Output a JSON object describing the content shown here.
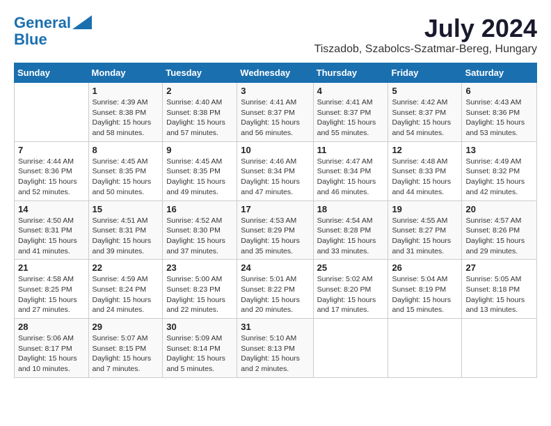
{
  "logo": {
    "text1": "General",
    "text2": "Blue"
  },
  "title": "July 2024",
  "location": "Tiszadob, Szabolcs-Szatmar-Bereg, Hungary",
  "headers": [
    "Sunday",
    "Monday",
    "Tuesday",
    "Wednesday",
    "Thursday",
    "Friday",
    "Saturday"
  ],
  "weeks": [
    [
      {
        "day": "",
        "info": ""
      },
      {
        "day": "1",
        "info": "Sunrise: 4:39 AM\nSunset: 8:38 PM\nDaylight: 15 hours\nand 58 minutes."
      },
      {
        "day": "2",
        "info": "Sunrise: 4:40 AM\nSunset: 8:38 PM\nDaylight: 15 hours\nand 57 minutes."
      },
      {
        "day": "3",
        "info": "Sunrise: 4:41 AM\nSunset: 8:37 PM\nDaylight: 15 hours\nand 56 minutes."
      },
      {
        "day": "4",
        "info": "Sunrise: 4:41 AM\nSunset: 8:37 PM\nDaylight: 15 hours\nand 55 minutes."
      },
      {
        "day": "5",
        "info": "Sunrise: 4:42 AM\nSunset: 8:37 PM\nDaylight: 15 hours\nand 54 minutes."
      },
      {
        "day": "6",
        "info": "Sunrise: 4:43 AM\nSunset: 8:36 PM\nDaylight: 15 hours\nand 53 minutes."
      }
    ],
    [
      {
        "day": "7",
        "info": "Sunrise: 4:44 AM\nSunset: 8:36 PM\nDaylight: 15 hours\nand 52 minutes."
      },
      {
        "day": "8",
        "info": "Sunrise: 4:45 AM\nSunset: 8:35 PM\nDaylight: 15 hours\nand 50 minutes."
      },
      {
        "day": "9",
        "info": "Sunrise: 4:45 AM\nSunset: 8:35 PM\nDaylight: 15 hours\nand 49 minutes."
      },
      {
        "day": "10",
        "info": "Sunrise: 4:46 AM\nSunset: 8:34 PM\nDaylight: 15 hours\nand 47 minutes."
      },
      {
        "day": "11",
        "info": "Sunrise: 4:47 AM\nSunset: 8:34 PM\nDaylight: 15 hours\nand 46 minutes."
      },
      {
        "day": "12",
        "info": "Sunrise: 4:48 AM\nSunset: 8:33 PM\nDaylight: 15 hours\nand 44 minutes."
      },
      {
        "day": "13",
        "info": "Sunrise: 4:49 AM\nSunset: 8:32 PM\nDaylight: 15 hours\nand 42 minutes."
      }
    ],
    [
      {
        "day": "14",
        "info": "Sunrise: 4:50 AM\nSunset: 8:31 PM\nDaylight: 15 hours\nand 41 minutes."
      },
      {
        "day": "15",
        "info": "Sunrise: 4:51 AM\nSunset: 8:31 PM\nDaylight: 15 hours\nand 39 minutes."
      },
      {
        "day": "16",
        "info": "Sunrise: 4:52 AM\nSunset: 8:30 PM\nDaylight: 15 hours\nand 37 minutes."
      },
      {
        "day": "17",
        "info": "Sunrise: 4:53 AM\nSunset: 8:29 PM\nDaylight: 15 hours\nand 35 minutes."
      },
      {
        "day": "18",
        "info": "Sunrise: 4:54 AM\nSunset: 8:28 PM\nDaylight: 15 hours\nand 33 minutes."
      },
      {
        "day": "19",
        "info": "Sunrise: 4:55 AM\nSunset: 8:27 PM\nDaylight: 15 hours\nand 31 minutes."
      },
      {
        "day": "20",
        "info": "Sunrise: 4:57 AM\nSunset: 8:26 PM\nDaylight: 15 hours\nand 29 minutes."
      }
    ],
    [
      {
        "day": "21",
        "info": "Sunrise: 4:58 AM\nSunset: 8:25 PM\nDaylight: 15 hours\nand 27 minutes."
      },
      {
        "day": "22",
        "info": "Sunrise: 4:59 AM\nSunset: 8:24 PM\nDaylight: 15 hours\nand 24 minutes."
      },
      {
        "day": "23",
        "info": "Sunrise: 5:00 AM\nSunset: 8:23 PM\nDaylight: 15 hours\nand 22 minutes."
      },
      {
        "day": "24",
        "info": "Sunrise: 5:01 AM\nSunset: 8:22 PM\nDaylight: 15 hours\nand 20 minutes."
      },
      {
        "day": "25",
        "info": "Sunrise: 5:02 AM\nSunset: 8:20 PM\nDaylight: 15 hours\nand 17 minutes."
      },
      {
        "day": "26",
        "info": "Sunrise: 5:04 AM\nSunset: 8:19 PM\nDaylight: 15 hours\nand 15 minutes."
      },
      {
        "day": "27",
        "info": "Sunrise: 5:05 AM\nSunset: 8:18 PM\nDaylight: 15 hours\nand 13 minutes."
      }
    ],
    [
      {
        "day": "28",
        "info": "Sunrise: 5:06 AM\nSunset: 8:17 PM\nDaylight: 15 hours\nand 10 minutes."
      },
      {
        "day": "29",
        "info": "Sunrise: 5:07 AM\nSunset: 8:15 PM\nDaylight: 15 hours\nand 7 minutes."
      },
      {
        "day": "30",
        "info": "Sunrise: 5:09 AM\nSunset: 8:14 PM\nDaylight: 15 hours\nand 5 minutes."
      },
      {
        "day": "31",
        "info": "Sunrise: 5:10 AM\nSunset: 8:13 PM\nDaylight: 15 hours\nand 2 minutes."
      },
      {
        "day": "",
        "info": ""
      },
      {
        "day": "",
        "info": ""
      },
      {
        "day": "",
        "info": ""
      }
    ]
  ]
}
